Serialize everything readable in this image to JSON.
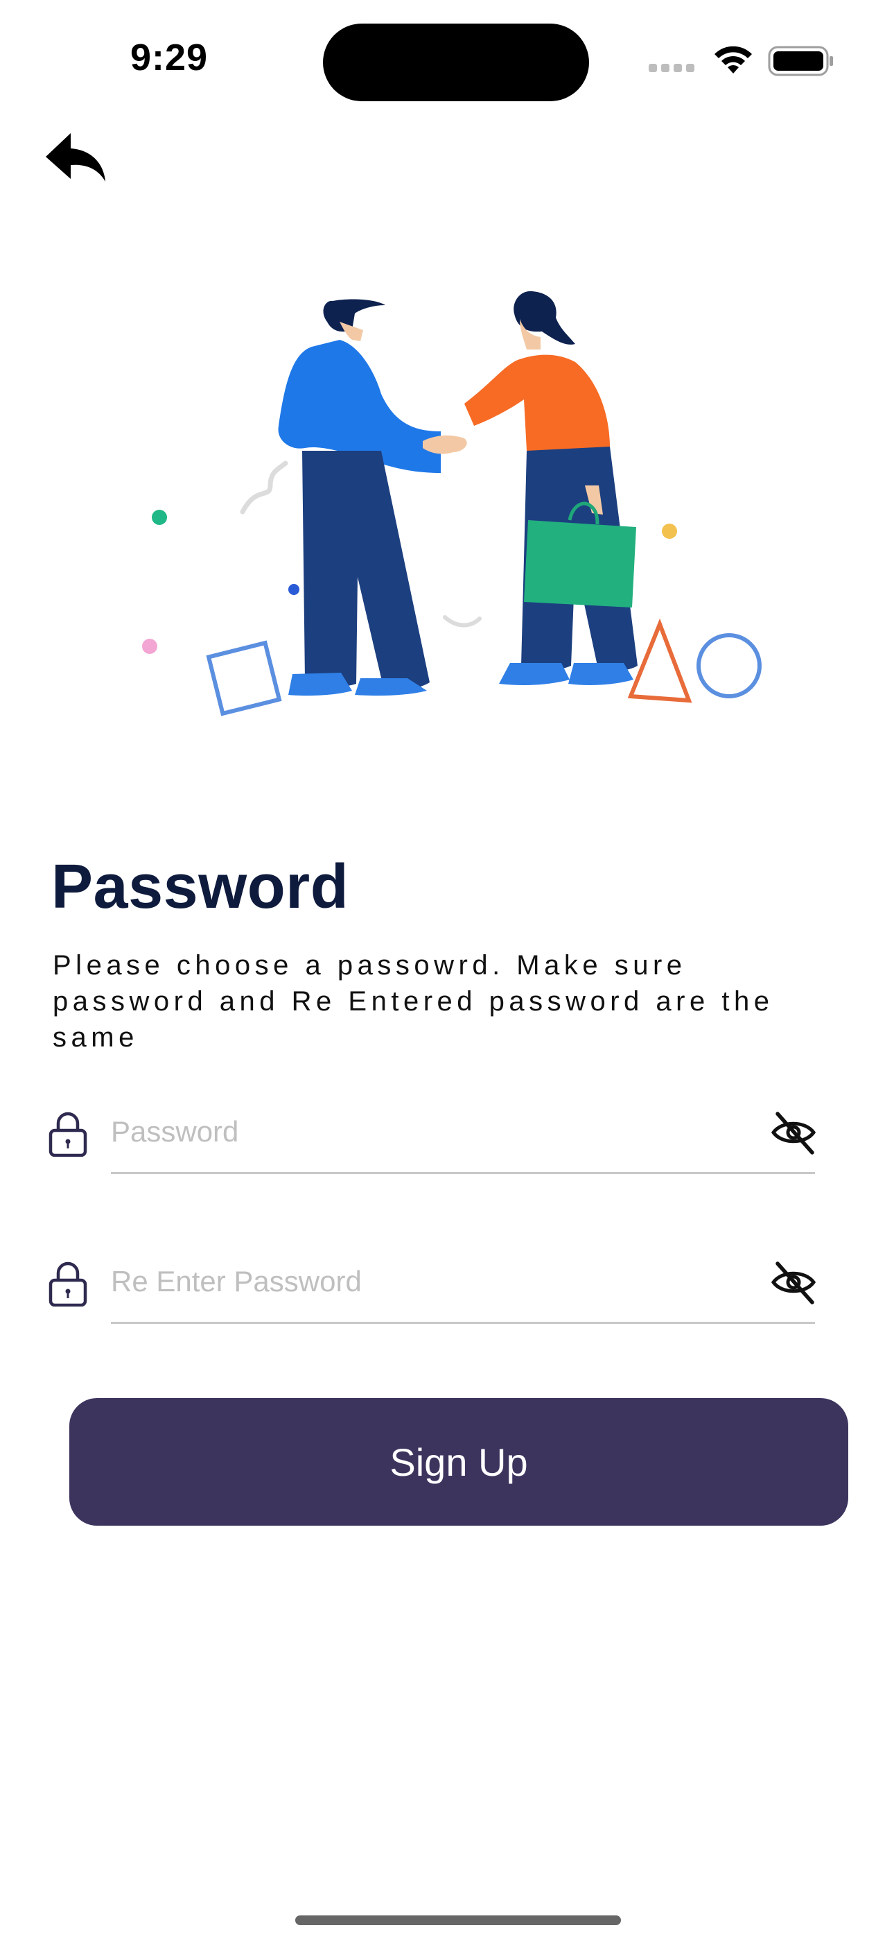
{
  "status_bar": {
    "time": "9:29"
  },
  "header": {
    "back_icon": "reply-arrow-icon"
  },
  "main": {
    "title": "Password",
    "subtitle": "Please choose a passowrd. Make sure password and Re Entered password are the same",
    "fields": [
      {
        "placeholder": "Password",
        "value": "",
        "icon": "lock-icon",
        "toggle_icon": "eye-slash-icon"
      },
      {
        "placeholder": "Re Enter Password",
        "value": "",
        "icon": "lock-icon",
        "toggle_icon": "eye-slash-icon"
      }
    ],
    "signup_label": "Sign Up"
  },
  "colors": {
    "primary": "#3d345e",
    "title": "#0f1b3d",
    "placeholder": "#bfbfbf"
  }
}
